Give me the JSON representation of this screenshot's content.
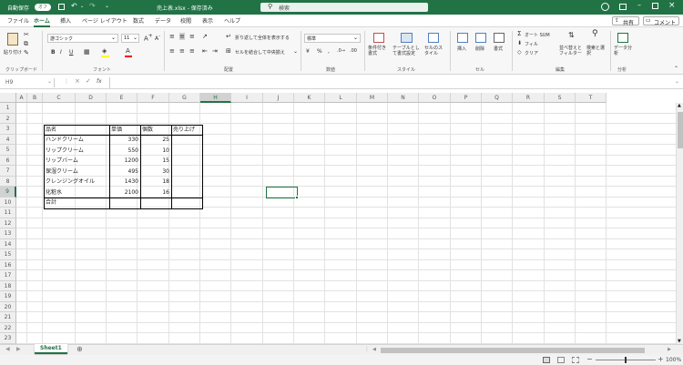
{
  "titlebar": {
    "autosave_label": "自動保存",
    "autosave_state": "オフ",
    "filename": "売上表.xlsx - 保存済み",
    "search_placeholder": "検索",
    "accent_color": "#217346"
  },
  "tabs": [
    "ファイル",
    "ホーム",
    "挿入",
    "ページ レイアウト",
    "数式",
    "データ",
    "校閲",
    "表示",
    "ヘルプ"
  ],
  "share": {
    "share_label": "共有",
    "comment_label": "コメント"
  },
  "ribbon": {
    "clipboard": {
      "paste_label": "貼り付け",
      "group": "クリップボード"
    },
    "font": {
      "font_name": "游ゴシック",
      "font_size": "11",
      "bold": "B",
      "italic": "I",
      "underline": "U",
      "group": "フォント"
    },
    "alignment": {
      "wrap_label": "折り返して全体を表示する",
      "merge_label": "セルを結合して中央揃え",
      "group": "配置"
    },
    "number": {
      "format": "標準",
      "group": "数値"
    },
    "styles": {
      "conditional": "条件付き書式",
      "table": "テーブルとして書式設定",
      "cell": "セルのスタイル",
      "group": "スタイル"
    },
    "cells": {
      "insert": "挿入",
      "delete": "削除",
      "format": "書式",
      "group": "セル"
    },
    "editing": {
      "autosum": "オート SUM",
      "fill": "フィル",
      "clear": "クリア",
      "sort": "並べ替えとフィルター",
      "find": "検索と選択",
      "group": "編集"
    },
    "analysis": {
      "analyze": "データ分析",
      "group": "分析"
    }
  },
  "formula_bar": {
    "name_box": "H9",
    "fx": "fx",
    "content": ""
  },
  "columns": [
    "A",
    "B",
    "C",
    "D",
    "E",
    "F",
    "G",
    "H",
    "I",
    "J",
    "K",
    "L",
    "M",
    "N",
    "O",
    "P",
    "Q",
    "R",
    "S",
    "T"
  ],
  "selected_column": "H",
  "rows": [
    "1",
    "2",
    "3",
    "4",
    "5",
    "6",
    "7",
    "8",
    "9",
    "10",
    "11",
    "12",
    "13",
    "14",
    "15",
    "16",
    "17",
    "18",
    "19",
    "20",
    "21",
    "22",
    "23"
  ],
  "table": {
    "headers": [
      "品名",
      "単価",
      "個数",
      "売り上げ"
    ],
    "rows": [
      {
        "name": "ハンドクリーム",
        "price": "330",
        "qty": "25"
      },
      {
        "name": "リップクリーム",
        "price": "550",
        "qty": "10"
      },
      {
        "name": "リップバーム",
        "price": "1200",
        "qty": "15"
      },
      {
        "name": "保湿クリーム",
        "price": "495",
        "qty": "30"
      },
      {
        "name": "クレンジングオイル",
        "price": "1430",
        "qty": "18"
      },
      {
        "name": "化粧水",
        "price": "2100",
        "qty": "16"
      }
    ],
    "total_label": "合計"
  },
  "sheet_tabs": [
    "Sheet1"
  ],
  "status": {
    "zoom": "100%"
  }
}
